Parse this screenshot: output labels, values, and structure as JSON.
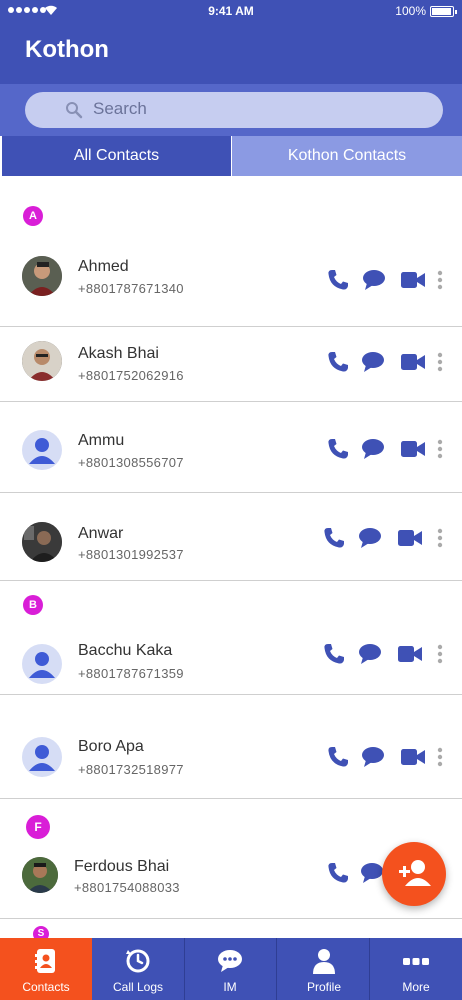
{
  "status_bar": {
    "time": "9:41 AM",
    "battery": "100%",
    "battery_level": 1.0
  },
  "app": {
    "title": "Kothon"
  },
  "search": {
    "placeholder": "Search",
    "icon": "search-icon"
  },
  "tabs": [
    {
      "label": "All Contacts",
      "active": true
    },
    {
      "label": "Kothon Contacts",
      "active": false
    }
  ],
  "sections": {
    "a": "A",
    "b": "B",
    "f": "F",
    "s": "S"
  },
  "contacts": [
    {
      "name": "Ahmed",
      "phone": "+8801787671340"
    },
    {
      "name": "Akash Bhai",
      "phone": "+8801752062916"
    },
    {
      "name": "Ammu",
      "phone": "+8801308556707"
    },
    {
      "name": "Anwar",
      "phone": "+8801301992537"
    },
    {
      "name": "Bacchu Kaka",
      "phone": "+8801787671359"
    },
    {
      "name": "Boro Apa",
      "phone": "+8801732518977"
    },
    {
      "name": "Ferdous Bhai",
      "phone": "+8801754088033"
    }
  ],
  "bottom_nav": [
    {
      "label": "Contacts",
      "icon": "contacts-icon",
      "active": true
    },
    {
      "label": "Call Logs",
      "icon": "call-logs-icon",
      "active": false
    },
    {
      "label": "IM",
      "icon": "chat-icon",
      "active": false
    },
    {
      "label": "Profile",
      "icon": "profile-icon",
      "active": false
    },
    {
      "label": "More",
      "icon": "more-icon",
      "active": false
    }
  ],
  "colors": {
    "primary": "#3f51b5",
    "accent": "#f4511e",
    "badge": "#d91ed7",
    "action_icon": "#3f51b5"
  }
}
